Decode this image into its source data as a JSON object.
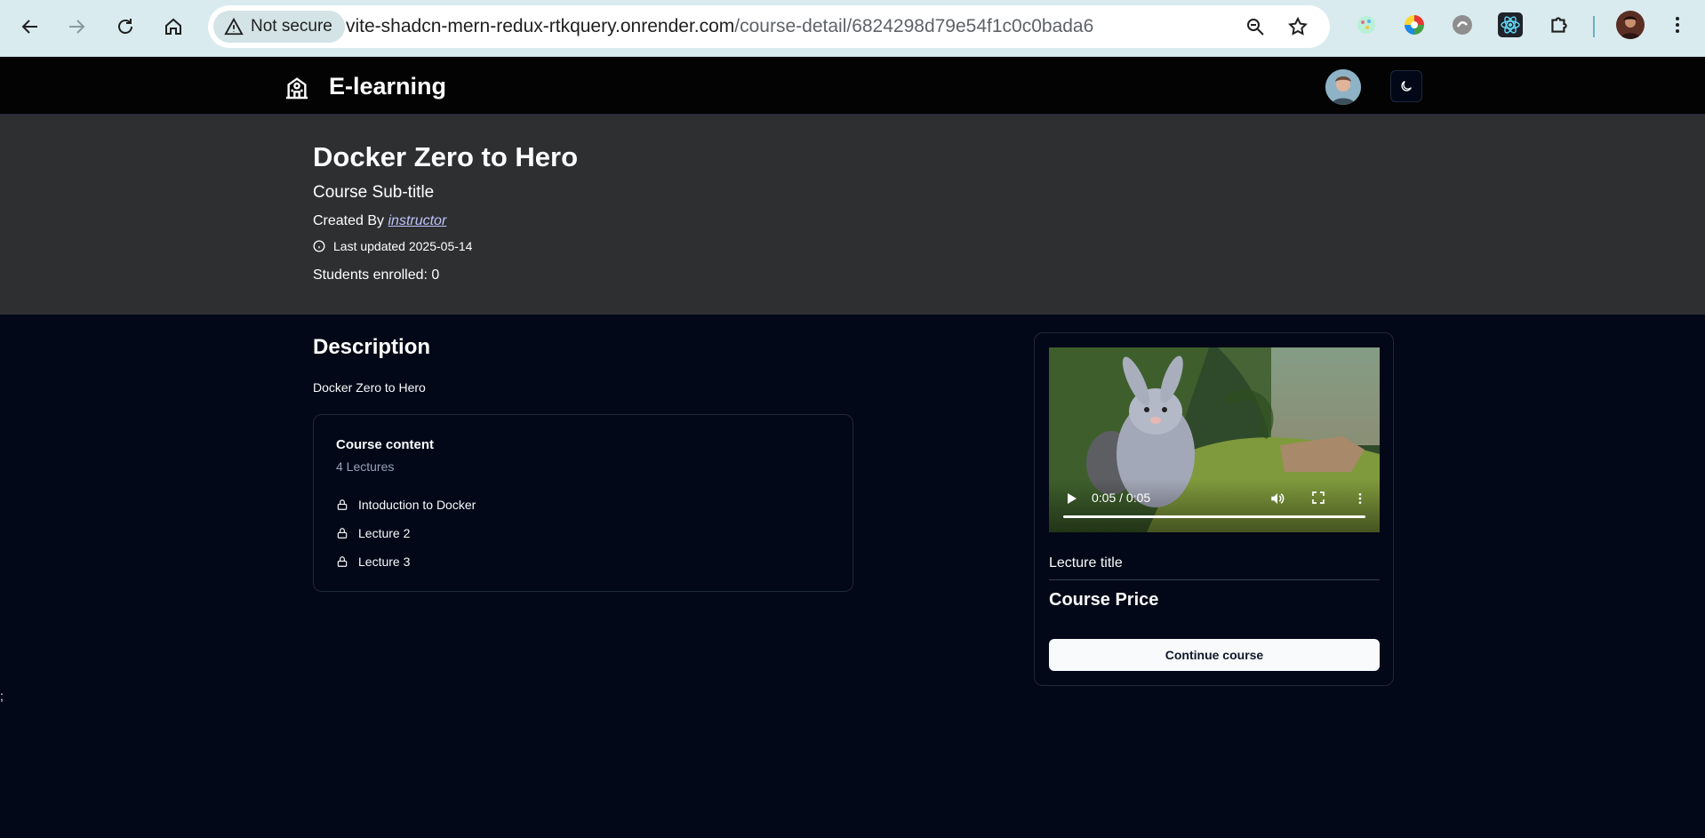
{
  "browser": {
    "security_label": "Not secure",
    "url_host": "vite-shadcn-mern-redux-rtkquery.onrender.com",
    "url_path": "/course-detail/6824298d79e54f1c0c0bada6"
  },
  "header": {
    "brand": "E-learning"
  },
  "hero": {
    "title": "Docker Zero to Hero",
    "subtitle": "Course Sub-title",
    "created_prefix": "Created By ",
    "creator": "instructor",
    "last_updated": "Last updated 2025-05-14",
    "students": "Students enrolled: 0"
  },
  "main": {
    "description_heading": "Description",
    "description_text": "Docker Zero to Hero",
    "content_card": {
      "title": "Course content",
      "count": "4 Lectures",
      "lectures": [
        {
          "label": "Intoduction to Docker",
          "icon": "lock-icon"
        },
        {
          "label": "Lecture 2",
          "icon": "lock-icon"
        },
        {
          "label": "Lecture 3",
          "icon": "lock-icon"
        }
      ]
    }
  },
  "side": {
    "video_time": "0:05 / 0:05",
    "video_progress": 1.0,
    "lecture_title": "Lecture title",
    "price_label": "Course Price",
    "continue_label": "Continue course"
  },
  "stray_text": ";",
  "colors": {
    "page_bg": "#020817",
    "hero_bg": "#2d2f31",
    "header_bg": "#030303",
    "chrome_bg": "#d9ebee",
    "link": "#c0c4fc"
  }
}
